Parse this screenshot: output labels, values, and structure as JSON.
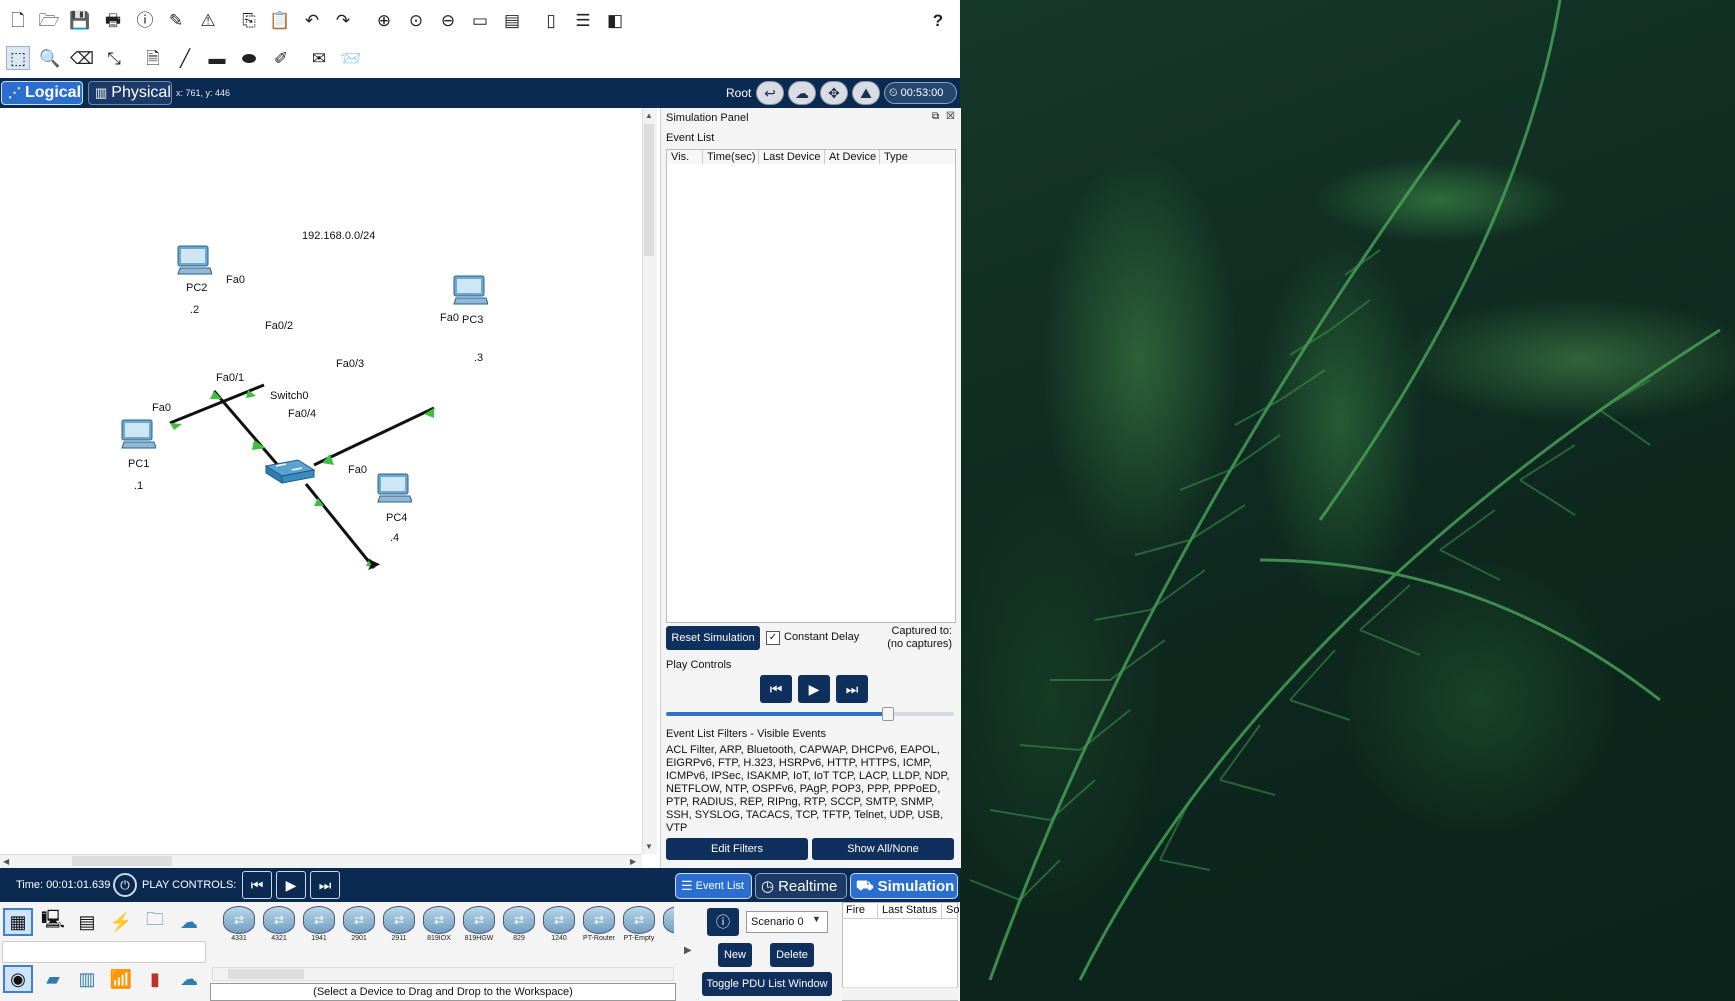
{
  "toolbar_top": {
    "icons": [
      "new-file-icon",
      "open-folder-icon",
      "save-icon",
      "print-icon",
      "info-icon",
      "activity-wizard-icon",
      "custom-device-icon",
      "copy-icon",
      "paste-icon",
      "undo-icon",
      "redo-icon",
      "zoom-in-icon",
      "zoom-reset-icon",
      "zoom-out-icon",
      "drawing-palette-icon",
      "custom-devices-dialog-icon",
      "view-command-log-icon",
      "device-icon",
      "pdu-icon"
    ],
    "help": "?"
  },
  "toolbar_second": {
    "icons": [
      "select-icon",
      "inspect-icon",
      "delete-icon",
      "resize-icon",
      "place-note-icon",
      "draw-line-icon",
      "draw-rectangle-icon",
      "draw-ellipse-icon",
      "draw-freeform-icon",
      "add-simple-pdu-icon",
      "add-complex-pdu-icon"
    ]
  },
  "modebar": {
    "logical_label": "Logical",
    "physical_label": "Physical",
    "coords": "x: 761, y: 446",
    "root_label": "Root",
    "clock": "00:53:00"
  },
  "topology": {
    "network_label": "192.168.0.0/24",
    "switch": {
      "name": "Switch0"
    },
    "pcs": [
      {
        "name": "PC1",
        "ip": ".1",
        "port": "Fa0",
        "switch_port": "Fa0/1"
      },
      {
        "name": "PC2",
        "ip": ".2",
        "port": "Fa0",
        "switch_port": "Fa0/2"
      },
      {
        "name": "PC3",
        "ip": ".3",
        "port": "Fa0",
        "switch_port": "Fa0/3"
      },
      {
        "name": "PC4",
        "ip": ".4",
        "port": "Fa0",
        "switch_port": "Fa0/4"
      }
    ],
    "link_color": "#111111",
    "port_light_color": "#3fbf3f"
  },
  "sim_panel": {
    "title": "Simulation Panel",
    "event_list_label": "Event List",
    "columns": [
      "Vis.",
      "Time(sec)",
      "Last Device",
      "At Device",
      "Type"
    ],
    "reset_label": "Reset Simulation",
    "constant_delay_label": "Constant Delay",
    "constant_delay_checked": true,
    "captured_line1": "Captured to:",
    "captured_line2": "(no captures)",
    "play_controls_label": "Play Controls",
    "speed_fraction": 0.77,
    "filters_label": "Event List Filters - Visible Events",
    "filters_text": "ACL Filter, ARP, Bluetooth, CAPWAP, DHCPv6, EAPOL, EIGRPv6, FTP, H.323, HSRPv6, HTTP, HTTPS, ICMP, ICMPv6, IPSec, ISAKMP, IoT, IoT TCP, LACP, LLDP, NDP, NETFLOW, NTP, OSPFv6, PAgP, POP3, PPP, PPPoED, PTP, RADIUS, REP, RIPng, RTP, SCCP, SMTP, SNMP, SSH, SYSLOG, TACACS, TCP, TFTP, Telnet, UDP, USB, VTP",
    "edit_filters_label": "Edit Filters",
    "show_all_label": "Show All/None"
  },
  "bottom_bar": {
    "time_label": "Time: 00:01:01.639",
    "play_controls_label": "PLAY CONTROLS:",
    "event_list_tab": "Event List",
    "realtime_tab": "Realtime",
    "simulation_tab": "Simulation"
  },
  "palette": {
    "devices": [
      "4331",
      "4321",
      "1941",
      "2901",
      "2911",
      "819IOX",
      "819HGW",
      "829",
      "1240",
      "PT-Router",
      "PT-Empty",
      "184"
    ],
    "select_hint": "(Select a Device to Drag and Drop to the Workspace)",
    "scenario": "Scenario 0",
    "new_label": "New",
    "delete_label": "Delete",
    "toggle_pdu_label": "Toggle PDU List Window",
    "pdu_columns": [
      "Fire",
      "Last Status",
      "So"
    ]
  },
  "colors": {
    "navy": "#0b2a52",
    "accent_blue": "#2a6fd0",
    "button_dark": "#0f2f5c"
  }
}
